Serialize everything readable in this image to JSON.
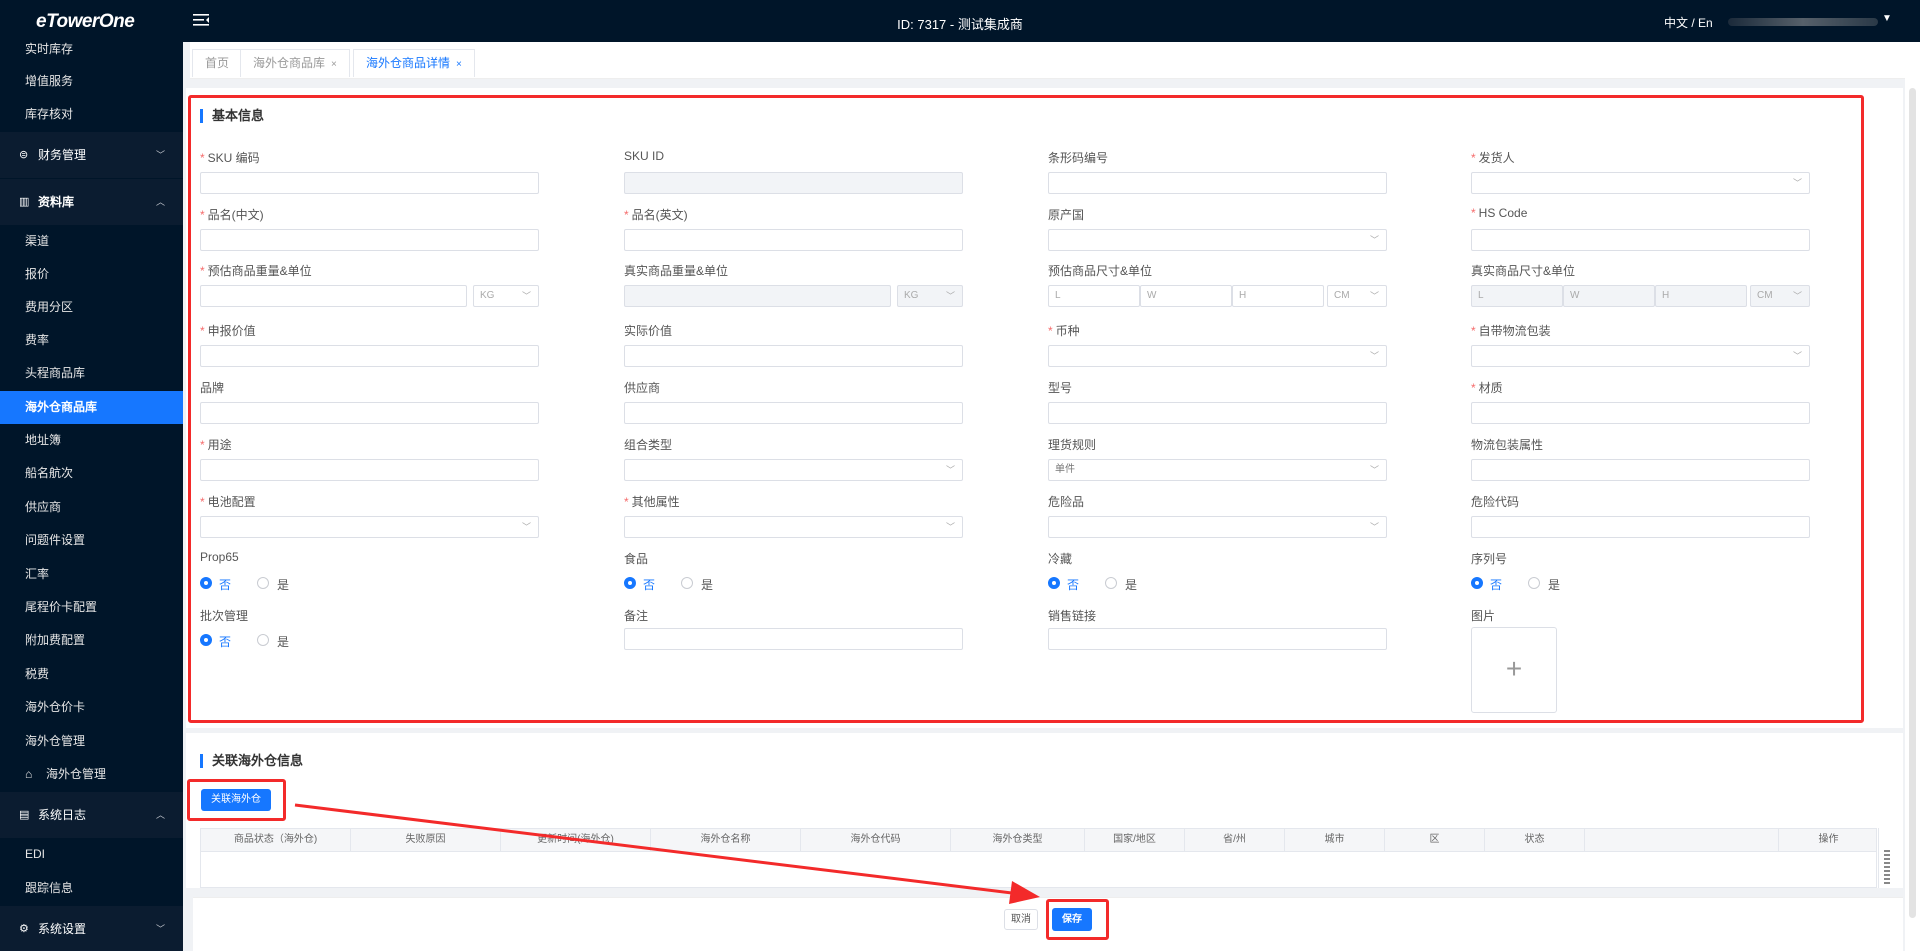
{
  "app": {
    "logo": "eTowerOne",
    "title": "ID: 7317 - 测试集成商",
    "lang": "中文 / En"
  },
  "sidebar": {
    "items_top": [
      "实时库存",
      "增值服务",
      "库存核对"
    ],
    "finance_group": "财务管理",
    "data_group": "资料库",
    "data_items": [
      "渠道",
      "报价",
      "费用分区",
      "费率",
      "头程商品库",
      "海外仓商品库",
      "地址簿",
      "船名航次",
      "供应商",
      "问题件设置",
      "汇率",
      "尾程价卡配置",
      "附加费配置",
      "税费",
      "海外仓价卡",
      "海外仓管理"
    ],
    "sub_item": "海外仓管理",
    "log_group": "系统日志",
    "log_items": [
      "EDI",
      "跟踪信息"
    ],
    "settings_group": "系统设置"
  },
  "tabs": [
    {
      "label": "首页"
    },
    {
      "label": "海外仓商品库",
      "close": "×"
    },
    {
      "label": "海外仓商品详情",
      "close": "×"
    }
  ],
  "basic": {
    "title": "基本信息",
    "fields": {
      "sku_code": "SKU 编码",
      "sku_id": "SKU ID",
      "barcode": "条形码编号",
      "shipper": "发货人",
      "name_cn": "品名(中文)",
      "name_en": "品名(英文)",
      "origin": "原产国",
      "hs_code": "HS Code",
      "est_weight": "预估商品重量&单位",
      "real_weight": "真实商品重量&单位",
      "est_size": "预估商品尺寸&单位",
      "real_size": "真实商品尺寸&单位",
      "declared_value": "申报价值",
      "actual_value": "实际价值",
      "currency": "币种",
      "own_package": "自带物流包装",
      "brand": "品牌",
      "supplier": "供应商",
      "model": "型号",
      "material": "材质",
      "usage": "用途",
      "combo_type": "组合类型",
      "picking_rule": "理货规则",
      "pack_attr": "物流包装属性",
      "battery": "电池配置",
      "other_attr": "其他属性",
      "dangerous": "危险品",
      "danger_code": "危险代码",
      "prop65": "Prop65",
      "food": "食品",
      "cold": "冷藏",
      "serial": "序列号",
      "batch": "批次管理",
      "remark": "备注",
      "sales_link": "销售链接",
      "image": "图片"
    },
    "units": {
      "kg": "KG",
      "cm": "CM",
      "l": "L",
      "w": "W",
      "h": "H"
    },
    "picking_value": "单件",
    "radio": {
      "no": "否",
      "yes": "是"
    }
  },
  "related": {
    "title": "关联海外仓信息",
    "link_button": "关联海外仓",
    "columns": [
      "商品状态（海外仓)",
      "失败原因",
      "更新时间(海外仓)",
      "海外仓名称",
      "海外仓代码",
      "海外仓类型",
      "国家/地区",
      "省/州",
      "城市",
      "区",
      "状态",
      "操作"
    ]
  },
  "footer": {
    "cancel": "取消",
    "save": "保存"
  }
}
